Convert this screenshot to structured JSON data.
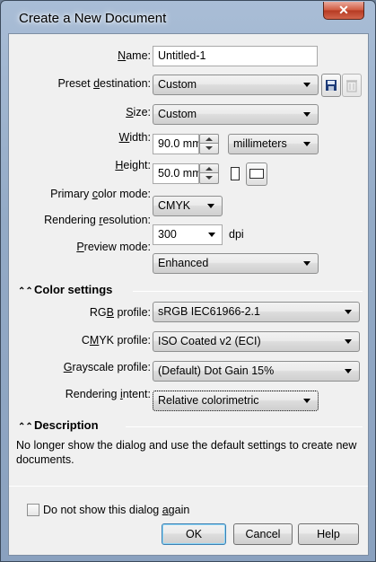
{
  "window": {
    "title": "Create a New Document",
    "close_glyph": "✕"
  },
  "form": {
    "name": {
      "label_pre": "",
      "label_ul": "N",
      "label_post": "ame:",
      "value": "Untitled-1"
    },
    "preset": {
      "label_pre": "Preset ",
      "label_ul": "d",
      "label_post": "estination:",
      "value": "Custom"
    },
    "size": {
      "label_pre": "",
      "label_ul": "S",
      "label_post": "ize:",
      "value": "Custom"
    },
    "width": {
      "label_pre": "",
      "label_ul": "W",
      "label_post": "idth:",
      "value": "90.0 mm"
    },
    "units": {
      "value": "millimeters"
    },
    "height": {
      "label_pre": "",
      "label_ul": "H",
      "label_post": "eight:",
      "value": "50.0 mm"
    },
    "primary_color_mode": {
      "label_pre": "Primary ",
      "label_ul": "c",
      "label_post": "olor mode:",
      "value": "CMYK"
    },
    "rendering_resolution": {
      "label_pre": "Rendering ",
      "label_ul": "r",
      "label_post": "esolution:",
      "value": "300",
      "unit": "dpi"
    },
    "preview_mode": {
      "label_pre": "",
      "label_ul": "P",
      "label_post": "review mode:",
      "value": "Enhanced"
    }
  },
  "color_settings": {
    "heading": "Color settings",
    "rgb_profile": {
      "label_pre": "RG",
      "label_ul": "B",
      "label_post": " profile:",
      "value": "sRGB IEC61966-2.1"
    },
    "cmyk_profile": {
      "label_pre": "C",
      "label_ul": "M",
      "label_post": "YK profile:",
      "value": "ISO Coated v2 (ECI)"
    },
    "grayscale_profile": {
      "label_pre": "",
      "label_ul": "G",
      "label_post": "rayscale profile:",
      "value": "(Default) Dot Gain 15%"
    },
    "rendering_intent": {
      "label_pre": "Rendering ",
      "label_ul": "i",
      "label_post": "ntent:",
      "value": "Relative colorimetric"
    }
  },
  "description": {
    "heading": "Description",
    "text": "No longer show the dialog and use the default settings to create new documents."
  },
  "footer": {
    "checkbox_pre": "Do not show this dialog ",
    "checkbox_ul": "a",
    "checkbox_post": "gain",
    "checkbox_checked": false,
    "ok": "OK",
    "cancel": "Cancel",
    "help": "Help"
  },
  "icons": {
    "save": "save-icon",
    "delete": "trash-icon",
    "collapse": "collapse-chevron-icon"
  }
}
